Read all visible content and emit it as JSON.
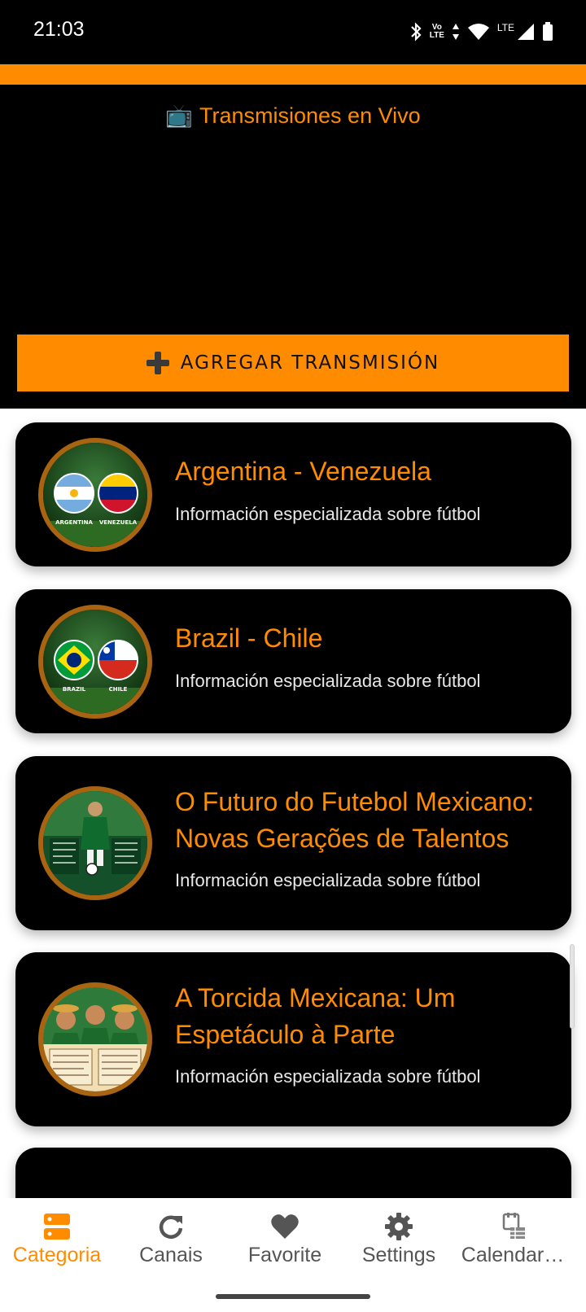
{
  "status_bar": {
    "time": "21:03",
    "volte_top": "Vo",
    "volte_bottom": "LTE",
    "lte": "LTE",
    "icons": [
      "bluetooth-icon",
      "volte-icon",
      "data-arrows-icon",
      "wifi-icon",
      "signal-icon",
      "battery-icon"
    ]
  },
  "header": {
    "title": "Transmisiones en Vivo",
    "tv_icon": "📺",
    "add_button": "AGREGAR TRANSMISIÓN"
  },
  "cards": [
    {
      "title": "Argentina - Venezuela",
      "description": "Información especializada sobre fútbol",
      "image": "argentina-venezuela-flags",
      "flag_left": "ARGENTINA",
      "flag_right": "VENEZUELA"
    },
    {
      "title": "Brazil - Chile",
      "description": "Información especializada sobre fútbol",
      "image": "brazil-chile-flags",
      "flag_left": "BRAZIL",
      "flag_right": "CHILE"
    },
    {
      "title": "O Futuro do Futebol Mexicano: Novas Gerações de Talentos",
      "description": "Información especializada sobre fútbol",
      "image": "mexican-football-infographic"
    },
    {
      "title": "A Torcida Mexicana: Um Espetáculo à Parte",
      "description": "Información especializada sobre fútbol",
      "image": "mexican-fans-illustration"
    }
  ],
  "bottom_nav": {
    "items": [
      {
        "label": "Categoria",
        "icon": "category-icon",
        "active": true
      },
      {
        "label": "Canais",
        "icon": "refresh-icon",
        "active": false
      },
      {
        "label": "Favorite",
        "icon": "heart-icon",
        "active": false
      },
      {
        "label": "Settings",
        "icon": "gear-icon",
        "active": false
      },
      {
        "label": "Calendar…",
        "icon": "calendar-icon",
        "active": false
      }
    ]
  },
  "colors": {
    "accent": "#ff8c00",
    "background": "#000000",
    "card": "#000000",
    "text_muted": "#e8e8e8"
  }
}
